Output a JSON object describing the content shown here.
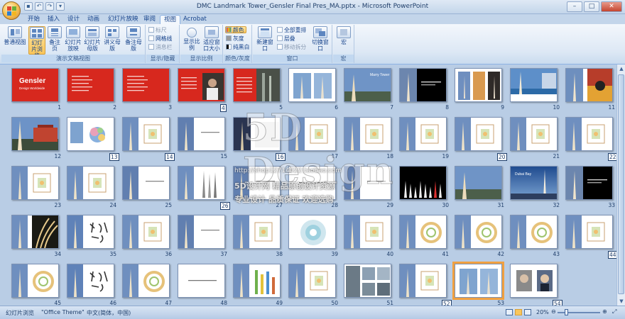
{
  "window": {
    "title": "DMC Landmark Tower_Gensler Final Pres_MA.pptx - Microsoft PowerPoint",
    "minimize": "–",
    "maximize": "□",
    "close": "✕"
  },
  "tabs": [
    "开始",
    "插入",
    "设计",
    "动画",
    "幻灯片放映",
    "审阅",
    "视图",
    "Acrobat"
  ],
  "active_tab": "视图",
  "ribbon": {
    "groups": {
      "presentation_views": "演示文稿视图",
      "show_hide": "显示/隐藏",
      "zoom": "显示比例",
      "color_gray": "颜色/灰度",
      "window": "窗口",
      "macro": "宏"
    },
    "buttons": {
      "normal_view": "普通视图",
      "slide_sorter": "幻灯片浏览",
      "notes_page": "备注页",
      "slide_show": "幻灯片放映",
      "slide_master": "幻灯片母版",
      "handout_master": "讲义母版",
      "notes_master": "备注母版",
      "ruler": "标尺",
      "gridlines": "网格线",
      "message_bar": "消息栏",
      "zoom": "显示比例",
      "fit_window": "适应窗口大小",
      "color": "颜色",
      "grayscale": "灰度",
      "black_white": "纯黑白",
      "new_window": "新建窗口",
      "arrange_all": "全部重排",
      "cascade": "层叠",
      "move_split": "移动拆分",
      "switch_window": "切换窗口",
      "macro": "宏"
    }
  },
  "slides": [
    {
      "n": "1",
      "kind": "red-title",
      "title": "Gensler",
      "sub": "Design Worldwide"
    },
    {
      "n": "2",
      "kind": "red-list"
    },
    {
      "n": "3",
      "kind": "red-list"
    },
    {
      "n": "4",
      "kind": "red-photo"
    },
    {
      "n": "5",
      "kind": "red-photo-dark"
    },
    {
      "n": "6",
      "kind": "towers-white"
    },
    {
      "n": "7",
      "kind": "tower-sky",
      "title": "Marry Tower"
    },
    {
      "n": "8",
      "kind": "tower-dark"
    },
    {
      "n": "9",
      "kind": "tower-frames"
    },
    {
      "n": "10",
      "kind": "tower-sea"
    },
    {
      "n": "11",
      "kind": "tower-dancers"
    },
    {
      "n": "12",
      "kind": "tower-city"
    },
    {
      "n": "13",
      "kind": "diagram-white"
    },
    {
      "n": "14",
      "kind": "tower-plan"
    },
    {
      "n": "15",
      "kind": "tower-text"
    },
    {
      "n": "16",
      "kind": "tower-night"
    },
    {
      "n": "17",
      "kind": "tower-plan"
    },
    {
      "n": "18",
      "kind": "tower-plan"
    },
    {
      "n": "19",
      "kind": "tower-plan"
    },
    {
      "n": "20",
      "kind": "tower-plan"
    },
    {
      "n": "21",
      "kind": "tower-plan"
    },
    {
      "n": "22",
      "kind": "tower-plan"
    },
    {
      "n": "23",
      "kind": "tower-plan"
    },
    {
      "n": "24",
      "kind": "tower-plan"
    },
    {
      "n": "25",
      "kind": "tower-text"
    },
    {
      "n": "26",
      "kind": "tower-sketch"
    },
    {
      "n": "27",
      "kind": "tower-text"
    },
    {
      "n": "28",
      "kind": "white-text"
    },
    {
      "n": "29",
      "kind": "tower-text"
    },
    {
      "n": "30",
      "kind": "black-models"
    },
    {
      "n": "31",
      "kind": "tower-sky"
    },
    {
      "n": "32",
      "kind": "tower-sky-blue",
      "title": "Dubai Bay"
    },
    {
      "n": "33",
      "kind": "tower-dark"
    },
    {
      "n": "34",
      "kind": "tower-plants"
    },
    {
      "n": "35",
      "kind": "tower-callig"
    },
    {
      "n": "36",
      "kind": "tower-plan"
    },
    {
      "n": "37",
      "kind": "tower-text"
    },
    {
      "n": "38",
      "kind": "tower-plan"
    },
    {
      "n": "39",
      "kind": "circle-diagram"
    },
    {
      "n": "40",
      "kind": "tower-plan"
    },
    {
      "n": "41",
      "kind": "tower-ring"
    },
    {
      "n": "42",
      "kind": "tower-ring"
    },
    {
      "n": "43",
      "kind": "tower-ring"
    },
    {
      "n": "44",
      "kind": "tower-plan"
    },
    {
      "n": "45",
      "kind": "tower-ring"
    },
    {
      "n": "46",
      "kind": "tower-callig"
    },
    {
      "n": "47",
      "kind": "tower-ring"
    },
    {
      "n": "48",
      "kind": "white-text"
    },
    {
      "n": "49",
      "kind": "tower-bars"
    },
    {
      "n": "50",
      "kind": "tower-plan"
    },
    {
      "n": "51",
      "kind": "photo-grid"
    },
    {
      "n": "52",
      "kind": "tower-plan"
    },
    {
      "n": "53",
      "kind": "towers-white"
    },
    {
      "n": "54",
      "kind": "portraits"
    }
  ],
  "selected_slide": "53",
  "watermark": {
    "logo": "5D Design",
    "url": "http://shop12714022.taobao.com",
    "line2": "5D设计网 精品原创设计资源",
    "line3": "专业设计 品质保证 欢迎选购"
  },
  "status": {
    "view": "幻灯片浏览",
    "theme": "\"Office Theme\"",
    "language": "中文(简体，中国)",
    "zoom": "20%",
    "zoom_fraction": 0.2
  },
  "colors": {
    "gensler_red": "#d7281e",
    "selection": "#f0a040"
  }
}
